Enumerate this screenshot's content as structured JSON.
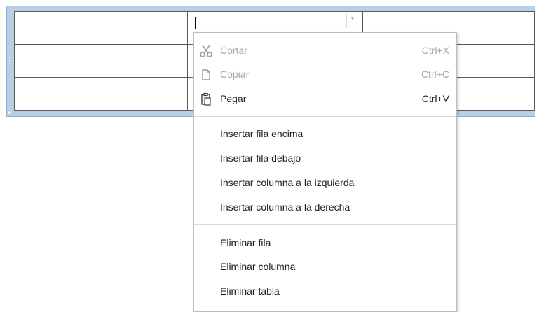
{
  "document": {
    "table": {
      "rows": [
        [
          "",
          "",
          ""
        ],
        [
          "",
          "",
          ""
        ],
        [
          "",
          "",
          ""
        ]
      ]
    }
  },
  "context_menu": {
    "clipboard": [
      {
        "id": "cut",
        "label": "Cortar",
        "shortcut": "Ctrl+X",
        "icon": "scissors-icon",
        "enabled": false
      },
      {
        "id": "copy",
        "label": "Copiar",
        "shortcut": "Ctrl+C",
        "icon": "copy-icon",
        "enabled": false
      },
      {
        "id": "paste",
        "label": "Pegar",
        "shortcut": "Ctrl+V",
        "icon": "paste-icon",
        "enabled": true
      }
    ],
    "insert": [
      {
        "id": "insert-row-above",
        "label": "Insertar fila encima"
      },
      {
        "id": "insert-row-below",
        "label": "Insertar fila debajo"
      },
      {
        "id": "insert-column-left",
        "label": "Insertar columna a la izquierda"
      },
      {
        "id": "insert-column-right",
        "label": "Insertar columna a la derecha"
      }
    ],
    "delete": [
      {
        "id": "delete-row",
        "label": "Eliminar fila"
      },
      {
        "id": "delete-column",
        "label": "Eliminar columna"
      },
      {
        "id": "delete-table",
        "label": "Eliminar tabla"
      }
    ]
  },
  "colors": {
    "frame": "#b9cfe8",
    "disabled_text": "#a8a8a8",
    "text": "#1e1e1e"
  }
}
